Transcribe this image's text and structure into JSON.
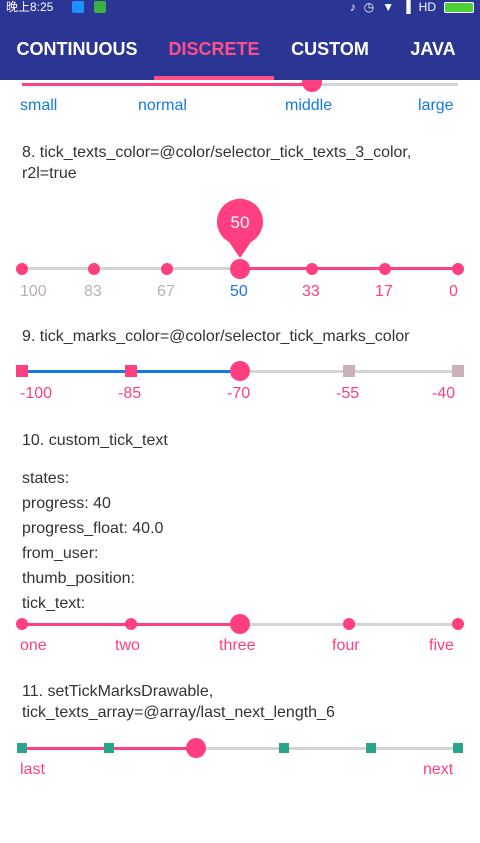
{
  "status_bar": {
    "time": "晚上8:25",
    "network": "HD"
  },
  "tabs": [
    {
      "label": "CONTINUOUS",
      "active": false
    },
    {
      "label": "DISCRETE",
      "active": true
    },
    {
      "label": "CUSTOM",
      "active": false
    },
    {
      "label": "JAVA",
      "active": false
    }
  ],
  "colors": {
    "primary": "#2b3594",
    "accent": "#ff3f81",
    "blue": "#1479e6",
    "track_gray": "#d4d4d4",
    "teal": "#2aa58c"
  },
  "section7": {
    "tick_labels": [
      "small",
      "normal",
      "middle",
      "large"
    ]
  },
  "section8": {
    "title": "8. tick_texts_color=@color/selector_tick_texts_3_color, r2l=true",
    "indicator": "50",
    "tick_labels": [
      "100",
      "83",
      "67",
      "50",
      "33",
      "17",
      "0"
    ]
  },
  "section9": {
    "title": "9. tick_marks_color=@color/selector_tick_marks_color",
    "tick_labels": [
      "-100",
      "-85",
      "-70",
      "-55",
      "-40"
    ]
  },
  "section10": {
    "title": "10. custom_tick_text",
    "info": {
      "states": "states:",
      "progress": "progress: 40",
      "progress_float": "progress_float: 40.0",
      "from_user": "from_user:",
      "thumb_position": "thumb_position:",
      "tick_text": "tick_text:"
    },
    "tick_labels": [
      "one",
      "two",
      "three",
      "four",
      "five"
    ]
  },
  "section11": {
    "title_line1": "11. setTickMarksDrawable,",
    "title_line2": "tick_texts_array=@array/last_next_length_6",
    "tick_labels": [
      "last",
      "next"
    ]
  }
}
